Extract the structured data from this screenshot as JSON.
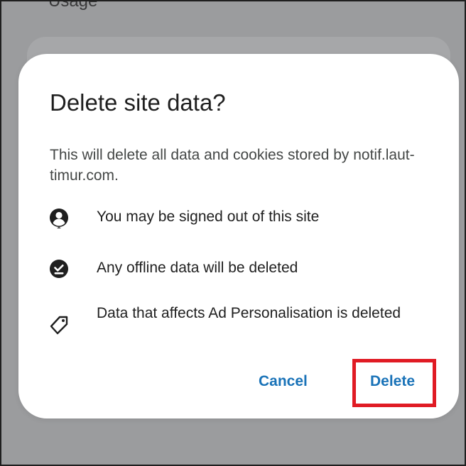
{
  "background": {
    "heading": "Usage"
  },
  "dialog": {
    "title": "Delete site data?",
    "description": "This will delete all data and cookies stored by notif.laut-timur.com.",
    "items": [
      {
        "icon": "account-circle-icon",
        "label": "You may be signed out of this site"
      },
      {
        "icon": "offline-check-icon",
        "label": "Any offline data will be deleted"
      },
      {
        "icon": "tag-icon",
        "label": "Data that affects Ad Personalisation is deleted"
      }
    ],
    "cancel_label": "Cancel",
    "delete_label": "Delete"
  },
  "colors": {
    "accent": "#1a73b8",
    "highlight": "#e01b24",
    "scrim": "#9b9c9e"
  }
}
